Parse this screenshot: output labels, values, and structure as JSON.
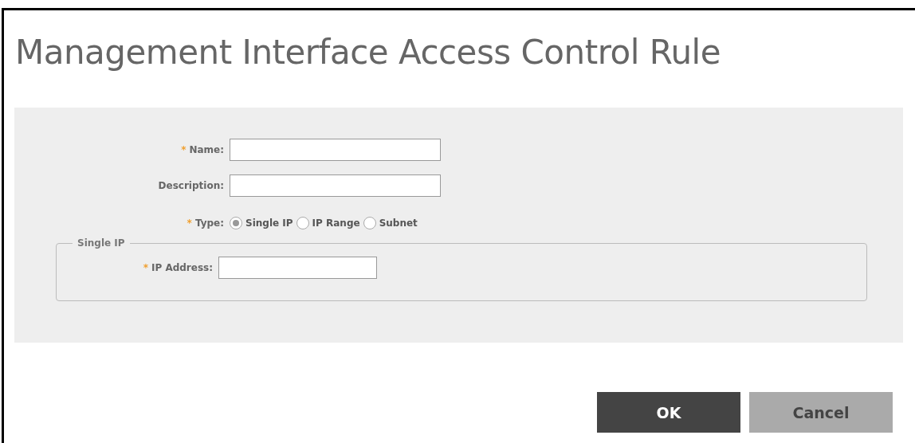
{
  "dialog": {
    "title": "Management Interface Access Control Rule"
  },
  "fields": [
    {
      "required_mark": "*",
      "label": "Name:",
      "kind": "text"
    },
    {
      "label": "Description:",
      "kind": "text"
    },
    {
      "required_mark": "*",
      "label": "Type:",
      "kind": "radio",
      "options": [
        {
          "label": "Single IP",
          "selected": true
        },
        {
          "label": "IP Range",
          "selected": false
        },
        {
          "label": "Subnet",
          "selected": false
        }
      ]
    }
  ],
  "group": {
    "legend": "Single IP",
    "fields": [
      {
        "required_mark": "*",
        "label": "IP Address:",
        "kind": "text"
      }
    ]
  },
  "buttons": [
    {
      "label": "OK",
      "kind": "primary"
    },
    {
      "label": "Cancel",
      "kind": "secondary"
    }
  ]
}
